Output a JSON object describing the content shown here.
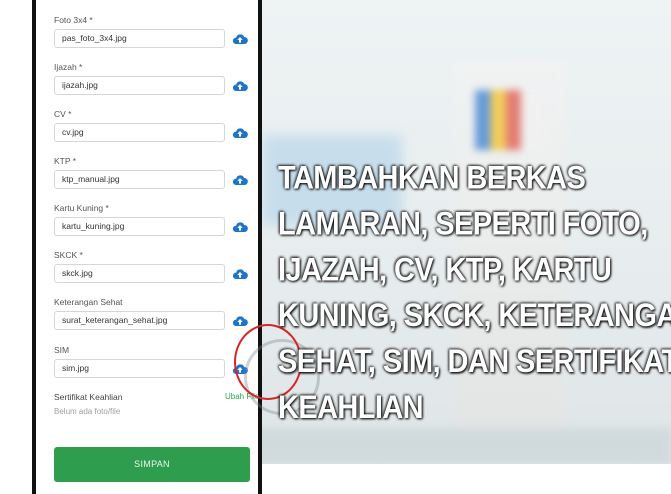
{
  "form": {
    "fields": [
      {
        "label": "Foto 3x4 *",
        "value": "pas_foto_3x4.jpg"
      },
      {
        "label": "Ijazah *",
        "value": "ijazah.jpg"
      },
      {
        "label": "CV *",
        "value": "cv.jpg"
      },
      {
        "label": "KTP *",
        "value": "ktp_manual.jpg"
      },
      {
        "label": "Kartu Kuning *",
        "value": "kartu_kuning.jpg"
      },
      {
        "label": "SKCK *",
        "value": "skck.jpg"
      },
      {
        "label": "Keterangan Sehat",
        "value": "surat_keterangan_sehat.jpg"
      },
      {
        "label": "SIM",
        "value": "sim.jpg"
      }
    ],
    "upload_icon": "upload-cloud-icon",
    "certificate": {
      "label": "Sertifikat Keahlian",
      "status": "Belum ada foto/file",
      "link": "Ubah File"
    },
    "save_label": "SIMPAN"
  },
  "caption": {
    "lines": [
      "TAMBAHKAN BERKAS",
      "LAMARAN, SEPERTI FOTO,",
      "IJAZAH, CV, KTP, KARTU",
      "KUNING, SKCK, KETERANGAN",
      "SEHAT, SIM, DAN SERTIFIKAT",
      "KEAHLIAN"
    ]
  },
  "colors": {
    "accent_blue": "#1e74c9",
    "save_green": "#2e9e4e",
    "highlight_red": "#d7262a"
  }
}
